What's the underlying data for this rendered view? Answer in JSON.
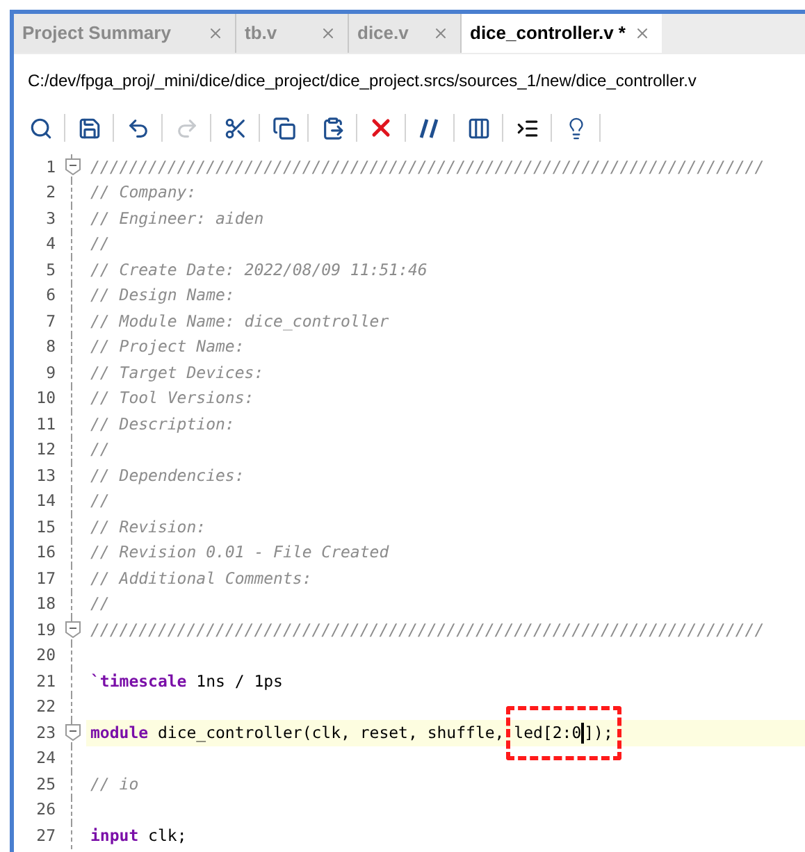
{
  "tabs": [
    {
      "label": "Project Summary",
      "selected": false
    },
    {
      "label": "tb.v",
      "selected": false
    },
    {
      "label": "dice.v",
      "selected": false
    },
    {
      "label": "dice_controller.v *",
      "selected": true
    }
  ],
  "file_path": "C:/dev/fpga_proj/_mini/dice/dice_project/dice_project.srcs/sources_1/new/dice_controller.v",
  "toolbar": [
    {
      "kind": "search",
      "disabled": false
    },
    {
      "kind": "save",
      "disabled": false
    },
    {
      "kind": "undo",
      "disabled": false
    },
    {
      "kind": "redo",
      "disabled": true
    },
    {
      "kind": "cut",
      "disabled": false
    },
    {
      "kind": "copy",
      "disabled": false
    },
    {
      "kind": "paste",
      "disabled": false
    },
    {
      "kind": "delete",
      "disabled": false
    },
    {
      "kind": "comment",
      "disabled": false
    },
    {
      "kind": "columns",
      "disabled": false
    },
    {
      "kind": "indent",
      "disabled": false
    },
    {
      "kind": "hint",
      "disabled": false
    }
  ],
  "editor": {
    "lines": [
      {
        "number": "1",
        "fold": true,
        "current": false,
        "segments": [
          {
            "kind": "comment",
            "text": "//////////////////////////////////////////////////////////////////////"
          }
        ]
      },
      {
        "number": "2",
        "fold": false,
        "current": false,
        "segments": [
          {
            "kind": "comment",
            "text": "// Company:"
          }
        ]
      },
      {
        "number": "3",
        "fold": false,
        "current": false,
        "segments": [
          {
            "kind": "comment",
            "text": "// Engineer: aiden"
          }
        ]
      },
      {
        "number": "4",
        "fold": false,
        "current": false,
        "segments": [
          {
            "kind": "comment",
            "text": "//"
          }
        ]
      },
      {
        "number": "5",
        "fold": false,
        "current": false,
        "segments": [
          {
            "kind": "comment",
            "text": "// Create Date: 2022/08/09 11:51:46"
          }
        ]
      },
      {
        "number": "6",
        "fold": false,
        "current": false,
        "segments": [
          {
            "kind": "comment",
            "text": "// Design Name:"
          }
        ]
      },
      {
        "number": "7",
        "fold": false,
        "current": false,
        "segments": [
          {
            "kind": "comment",
            "text": "// Module Name: dice_controller"
          }
        ]
      },
      {
        "number": "8",
        "fold": false,
        "current": false,
        "segments": [
          {
            "kind": "comment",
            "text": "// Project Name:"
          }
        ]
      },
      {
        "number": "9",
        "fold": false,
        "current": false,
        "segments": [
          {
            "kind": "comment",
            "text": "// Target Devices:"
          }
        ]
      },
      {
        "number": "10",
        "fold": false,
        "current": false,
        "segments": [
          {
            "kind": "comment",
            "text": "// Tool Versions:"
          }
        ]
      },
      {
        "number": "11",
        "fold": false,
        "current": false,
        "segments": [
          {
            "kind": "comment",
            "text": "// Description:"
          }
        ]
      },
      {
        "number": "12",
        "fold": false,
        "current": false,
        "segments": [
          {
            "kind": "comment",
            "text": "//"
          }
        ]
      },
      {
        "number": "13",
        "fold": false,
        "current": false,
        "segments": [
          {
            "kind": "comment",
            "text": "// Dependencies:"
          }
        ]
      },
      {
        "number": "14",
        "fold": false,
        "current": false,
        "segments": [
          {
            "kind": "comment",
            "text": "//"
          }
        ]
      },
      {
        "number": "15",
        "fold": false,
        "current": false,
        "segments": [
          {
            "kind": "comment",
            "text": "// Revision:"
          }
        ]
      },
      {
        "number": "16",
        "fold": false,
        "current": false,
        "segments": [
          {
            "kind": "comment",
            "text": "// Revision 0.01 - File Created"
          }
        ]
      },
      {
        "number": "17",
        "fold": false,
        "current": false,
        "segments": [
          {
            "kind": "comment",
            "text": "// Additional Comments:"
          }
        ]
      },
      {
        "number": "18",
        "fold": false,
        "current": false,
        "segments": [
          {
            "kind": "comment",
            "text": "//"
          }
        ]
      },
      {
        "number": "19",
        "fold": true,
        "current": false,
        "segments": [
          {
            "kind": "comment",
            "text": "//////////////////////////////////////////////////////////////////////"
          }
        ]
      },
      {
        "number": "20",
        "fold": false,
        "current": false
      },
      {
        "number": "21",
        "fold": false,
        "current": false,
        "segments": [
          {
            "kind": "keyword",
            "text": "`timescale"
          },
          {
            "kind": "plain",
            "text": " 1ns / 1ps"
          }
        ]
      },
      {
        "number": "22",
        "fold": false,
        "current": false
      },
      {
        "number": "23",
        "fold": true,
        "current": true,
        "segments": [
          {
            "kind": "keyword",
            "text": "module"
          },
          {
            "kind": "plain",
            "text": " dice_controller(clk, reset, shuffle, "
          }
        ],
        "annotation": {
          "segments": [
            {
              "kind": "plain",
              "text": "led[2:0",
              "cursor_after": true
            },
            {
              "kind": "plain",
              "text": "]);"
            }
          ]
        }
      },
      {
        "number": "24",
        "fold": false,
        "current": false
      },
      {
        "number": "25",
        "fold": false,
        "current": false,
        "segments": [
          {
            "kind": "comment",
            "text": "// io"
          }
        ]
      },
      {
        "number": "26",
        "fold": false,
        "current": false
      },
      {
        "number": "27",
        "fold": false,
        "current": false,
        "segments": [
          {
            "kind": "keyword",
            "text": "input"
          },
          {
            "kind": "plain",
            "text": " clk;"
          }
        ]
      }
    ]
  }
}
